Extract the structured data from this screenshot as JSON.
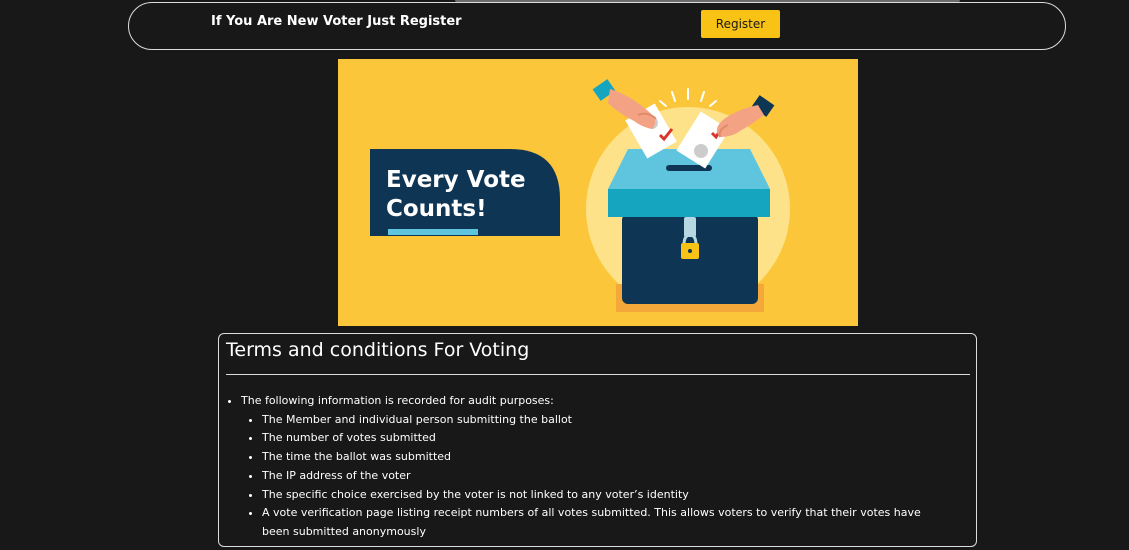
{
  "register_bar": {
    "prompt_text": "If You Are New Voter Just Register",
    "button_label": "Register"
  },
  "banner": {
    "headline_line1": "Every Vote",
    "headline_line2": "Counts!"
  },
  "terms": {
    "title": "Terms and conditions For Voting",
    "intro": "The following information is recorded for audit purposes:",
    "items": [
      "The Member and individual person submitting the ballot",
      "The number of votes submitted",
      "The time the ballot was submitted",
      "The IP address of the voter",
      "The specific choice exercised by the voter is not linked to any voter’s identity",
      "A vote verification page listing receipt numbers of all votes submitted. This allows voters to verify that their votes have been submitted anonymously"
    ]
  },
  "colors": {
    "page_background": "#181818",
    "accent_yellow": "#f8c314",
    "banner_background": "#fcc63a",
    "banner_navy": "#0f3554",
    "ballot_box_teal": "#16a5be",
    "text": "#ffffff"
  },
  "icons": [
    "ballot-box-icon",
    "padlock-icon",
    "hand-icon",
    "ballot-paper-icon"
  ]
}
